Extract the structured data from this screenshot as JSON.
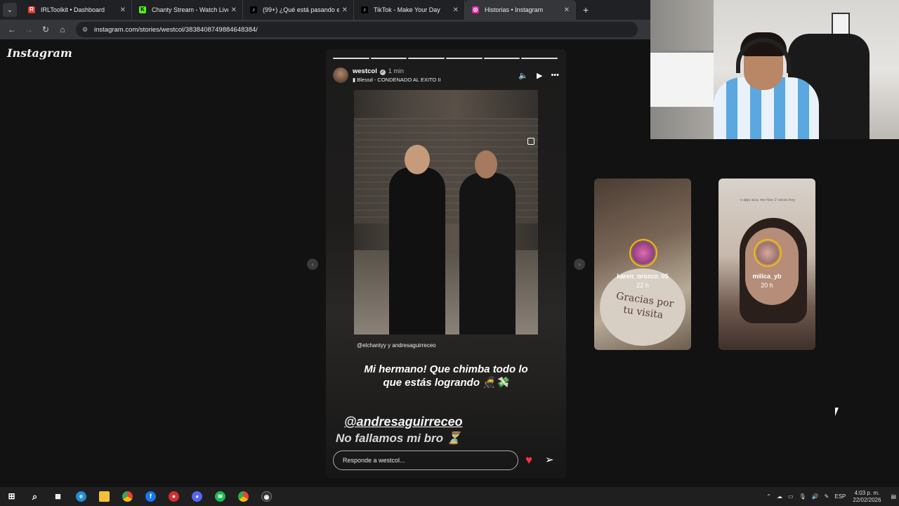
{
  "browser": {
    "tabs": [
      {
        "title": "IRLToolkit • Dashboard",
        "favicon_color": "#e53935",
        "favicon_glyph": "R",
        "active": false
      },
      {
        "title": "Chanty Stream - Watch Live on",
        "favicon_color": "#53fc18",
        "favicon_glyph": "K",
        "active": false
      },
      {
        "title": "(99+) ¿Qué está pasando en Jal",
        "favicon_color": "#000000",
        "favicon_glyph": "♪",
        "active": false
      },
      {
        "title": "TikTok - Make Your Day",
        "favicon_color": "#000000",
        "favicon_glyph": "♪",
        "active": false
      },
      {
        "title": "Historias • Instagram",
        "favicon_color": "#d6249f",
        "favicon_glyph": "◎",
        "active": true
      }
    ],
    "url": "instagram.com/stories/westcol/3838408749884648384/"
  },
  "instagram": {
    "logo": "Instagram",
    "story": {
      "username": "westcol",
      "time": "1 min",
      "song": "Blessd - CONDENADO AL EXITO II",
      "progress_segments": 6,
      "mention_line": "@elchantyy y andresaguirreceo",
      "caption": "Mi hermano! Que chimba todo lo que estás logrando 🥷💸",
      "tag": "@andresaguirreceo",
      "subtext": "No fallamos mi bro ⏳",
      "reply_placeholder": "Responde a westcol..."
    },
    "previews": [
      {
        "username": "karen_orozco_05",
        "time": "22 h",
        "plate_text": "Gracias por tu visita"
      },
      {
        "username": "milica_yb",
        "time": "20 h",
        "small_text": "v algo aca, me hizo 2 veces hoy"
      }
    ]
  },
  "taskbar": {
    "language": "ESP",
    "time": "4:03 p. m.",
    "date": "22/02/2026"
  }
}
